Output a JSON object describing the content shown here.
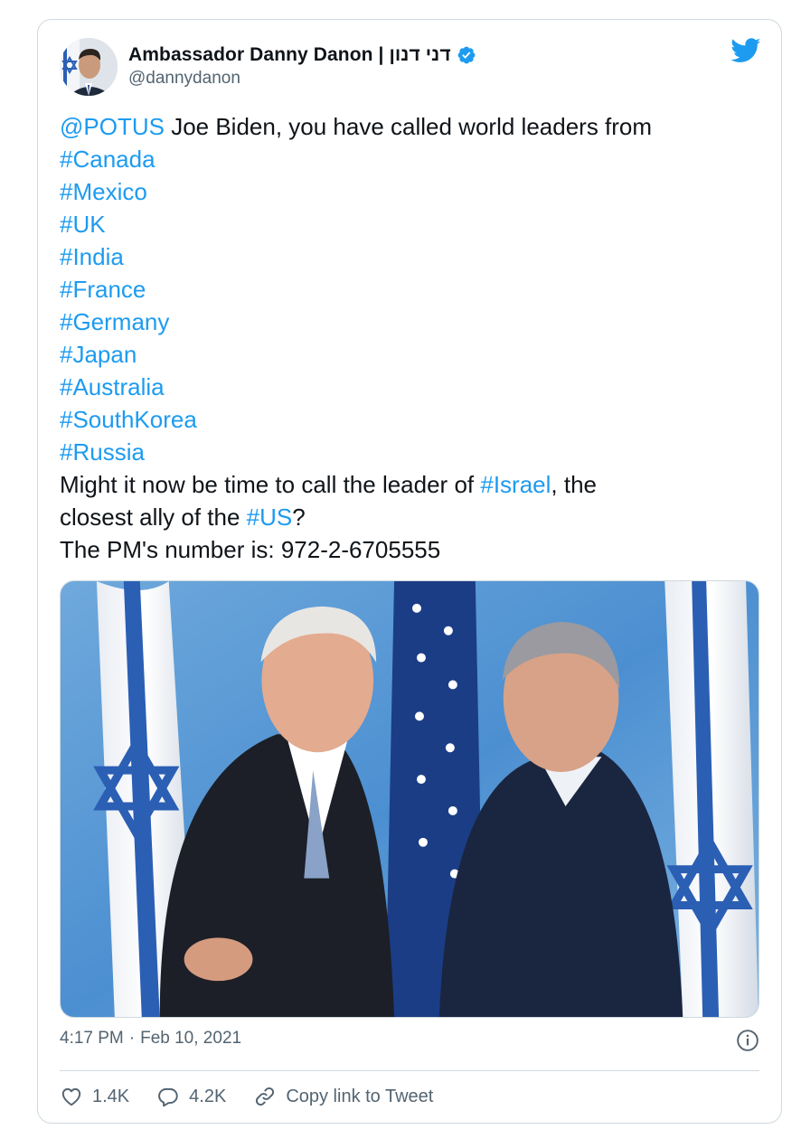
{
  "tweet": {
    "author": {
      "display_name": "Ambassador Danny Danon | דני דנון",
      "handle": "@dannydanon",
      "verified": true
    },
    "body_lines": [
      [
        {
          "text": "@POTUS",
          "link": true
        },
        {
          "text": " Joe Biden, you have called world leaders from",
          "link": false
        }
      ],
      [
        {
          "text": "#Canada",
          "link": true
        }
      ],
      [
        {
          "text": "#Mexico",
          "link": true
        }
      ],
      [
        {
          "text": "#UK",
          "link": true
        }
      ],
      [
        {
          "text": "#India",
          "link": true
        }
      ],
      [
        {
          "text": "#France",
          "link": true
        }
      ],
      [
        {
          "text": "#Germany",
          "link": true
        }
      ],
      [
        {
          "text": "#Japan",
          "link": true
        }
      ],
      [
        {
          "text": "#Australia",
          "link": true
        }
      ],
      [
        {
          "text": "#SouthKorea",
          "link": true
        }
      ],
      [
        {
          "text": "#Russia",
          "link": true
        }
      ],
      [
        {
          "text": "Might it now be time to call the leader of ",
          "link": false
        },
        {
          "text": "#Israel",
          "link": true
        },
        {
          "text": ", the",
          "link": false
        }
      ],
      [
        {
          "text": "closest ally of the ",
          "link": false
        },
        {
          "text": "#US",
          "link": true
        },
        {
          "text": "?",
          "link": false
        }
      ],
      [
        {
          "text": "The PM's number is: 972-2-6705555",
          "link": false
        }
      ]
    ],
    "time": "4:17 PM",
    "separator": "·",
    "date": "Feb 10, 2021",
    "actions": {
      "likes": "1.4K",
      "replies": "4.2K",
      "copy_link": "Copy link to Tweet"
    }
  },
  "icons": {
    "brand": "twitter-bird-icon",
    "verified": "verified-badge-icon",
    "info": "info-icon",
    "like": "heart-icon",
    "reply": "reply-bubble-icon",
    "link": "link-icon"
  },
  "colors": {
    "link": "#1d9bf0",
    "text": "#0f1419",
    "secondary": "#536471",
    "border": "#cfd9de",
    "brand": "#1d9bf0"
  }
}
